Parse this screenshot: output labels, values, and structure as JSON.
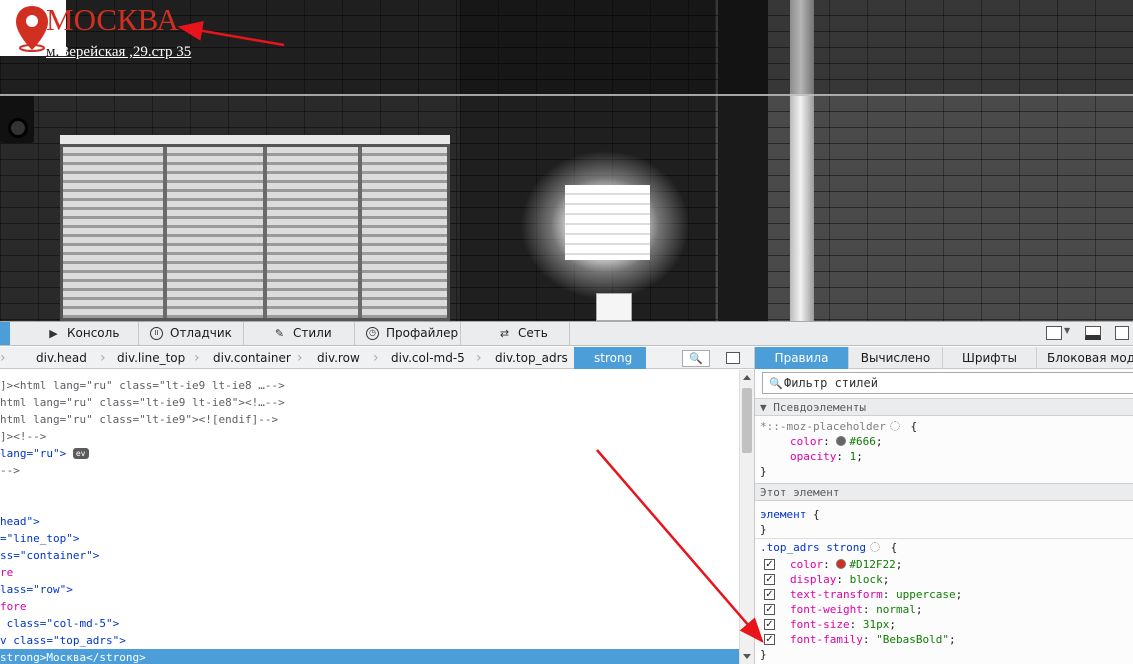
{
  "site": {
    "city": "МОСКВА",
    "address_prefix": "м.",
    "address": "Верейская ,29.стр 35",
    "pin_icon": "location-pin-icon",
    "accent_color": "#D12F22"
  },
  "devtools": {
    "tabs": [
      {
        "label": "Консоль",
        "icon": "console-icon"
      },
      {
        "label": "Отладчик",
        "icon": "debugger-icon"
      },
      {
        "label": "Стили",
        "icon": "style-editor-icon"
      },
      {
        "label": "Профайлер",
        "icon": "profiler-icon"
      },
      {
        "label": "Сеть",
        "icon": "network-icon"
      }
    ],
    "breadcrumbs": [
      "div.head",
      "div.line_top",
      "div.container",
      "div.row",
      "div.col-md-5",
      "div.top_adrs",
      "strong"
    ],
    "markup": {
      "lines": [
        "]><html lang=\"ru\" class=\"lt-ie9 lt-ie8 …-->",
        "html lang=\"ru\" class=\"lt-ie9 lt-ie8\"><!…-->",
        "html lang=\"ru\" class=\"lt-ie9\"><![endif]-->",
        "]><!-->",
        "lang=\"ru\">",
        "-->",
        "head\">",
        "=\"line_top\">",
        "ss=\"container\">",
        "re",
        "lass=\"row\">",
        "fore",
        " class=\"col-md-5\">",
        "v class=\"top_adrs\">",
        "strong>Москва</strong>"
      ],
      "ev_badge": "ev"
    },
    "sidebar": {
      "tabs": [
        "Правила",
        "Вычислено",
        "Шрифты",
        "Блоковая модель"
      ],
      "filter_placeholder": "Фильтр стилей",
      "pseudo_header": "Псевдоэлементы",
      "pseudo_selector": "*::-moz-placeholder",
      "pseudo_color_name": "color",
      "pseudo_color_value": "#666",
      "pseudo_opacity_name": "opacity",
      "pseudo_opacity_value": "1",
      "this_element_header": "Этот элемент",
      "element_selector": "элемент",
      "rule_selector": ".top_adrs strong",
      "rule_decls": [
        {
          "name": "color",
          "value": "#D12F22",
          "swatch": "#D12F22"
        },
        {
          "name": "display",
          "value": "block"
        },
        {
          "name": "text-transform",
          "value": "uppercase"
        },
        {
          "name": "font-weight",
          "value": "normal"
        },
        {
          "name": "font-size",
          "value": "31px"
        },
        {
          "name": "font-family",
          "value": "\"BebasBold\""
        }
      ]
    }
  }
}
